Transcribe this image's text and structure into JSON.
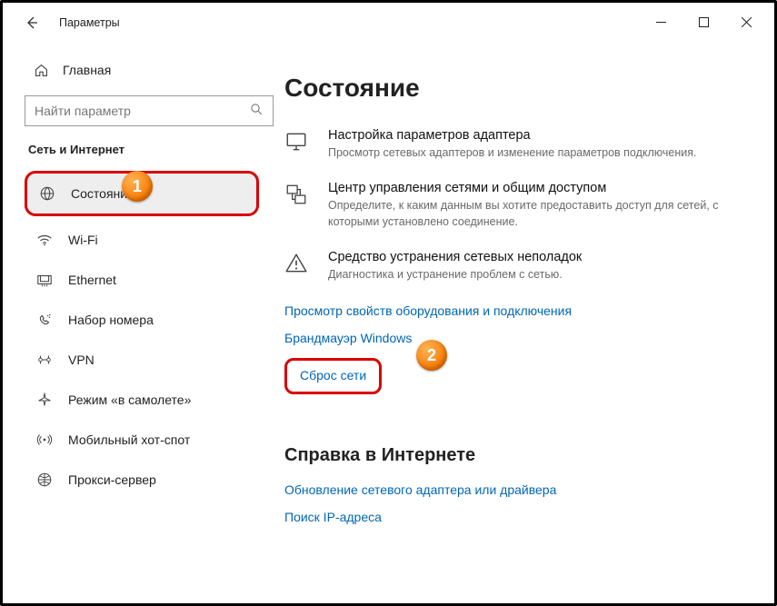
{
  "titlebar": {
    "title": "Параметры"
  },
  "sidebar": {
    "home": "Главная",
    "search_placeholder": "Найти параметр",
    "section": "Сеть и Интернет",
    "items": [
      {
        "icon": "status",
        "label": "Состояние"
      },
      {
        "icon": "wifi",
        "label": "Wi-Fi"
      },
      {
        "icon": "ethernet",
        "label": "Ethernet"
      },
      {
        "icon": "dialup",
        "label": "Набор номера"
      },
      {
        "icon": "vpn",
        "label": "VPN"
      },
      {
        "icon": "airplane",
        "label": "Режим «в самолете»"
      },
      {
        "icon": "hotspot",
        "label": "Мобильный хот-спот"
      },
      {
        "icon": "proxy",
        "label": "Прокси-сервер"
      }
    ]
  },
  "main": {
    "title": "Состояние",
    "cards": [
      {
        "title": "Настройка параметров адаптера",
        "desc": "Просмотр сетевых адаптеров и изменение параметров подключения."
      },
      {
        "title": "Центр управления сетями и общим доступом",
        "desc": "Определите, к каким данным вы хотите предоставить доступ для сетей, с которыми установлено соединение."
      },
      {
        "title": "Средство устранения сетевых неполадок",
        "desc": "Диагностика и устранение проблем с сетью."
      }
    ],
    "links": [
      "Просмотр свойств оборудования и подключения",
      "Брандмауэр Windows",
      "Сброс сети"
    ],
    "help_title": "Справка в Интернете",
    "help_links": [
      "Обновление сетевого адаптера или драйвера",
      "Поиск IP-адреса"
    ]
  },
  "annotations": {
    "badge1": "1",
    "badge2": "2"
  }
}
